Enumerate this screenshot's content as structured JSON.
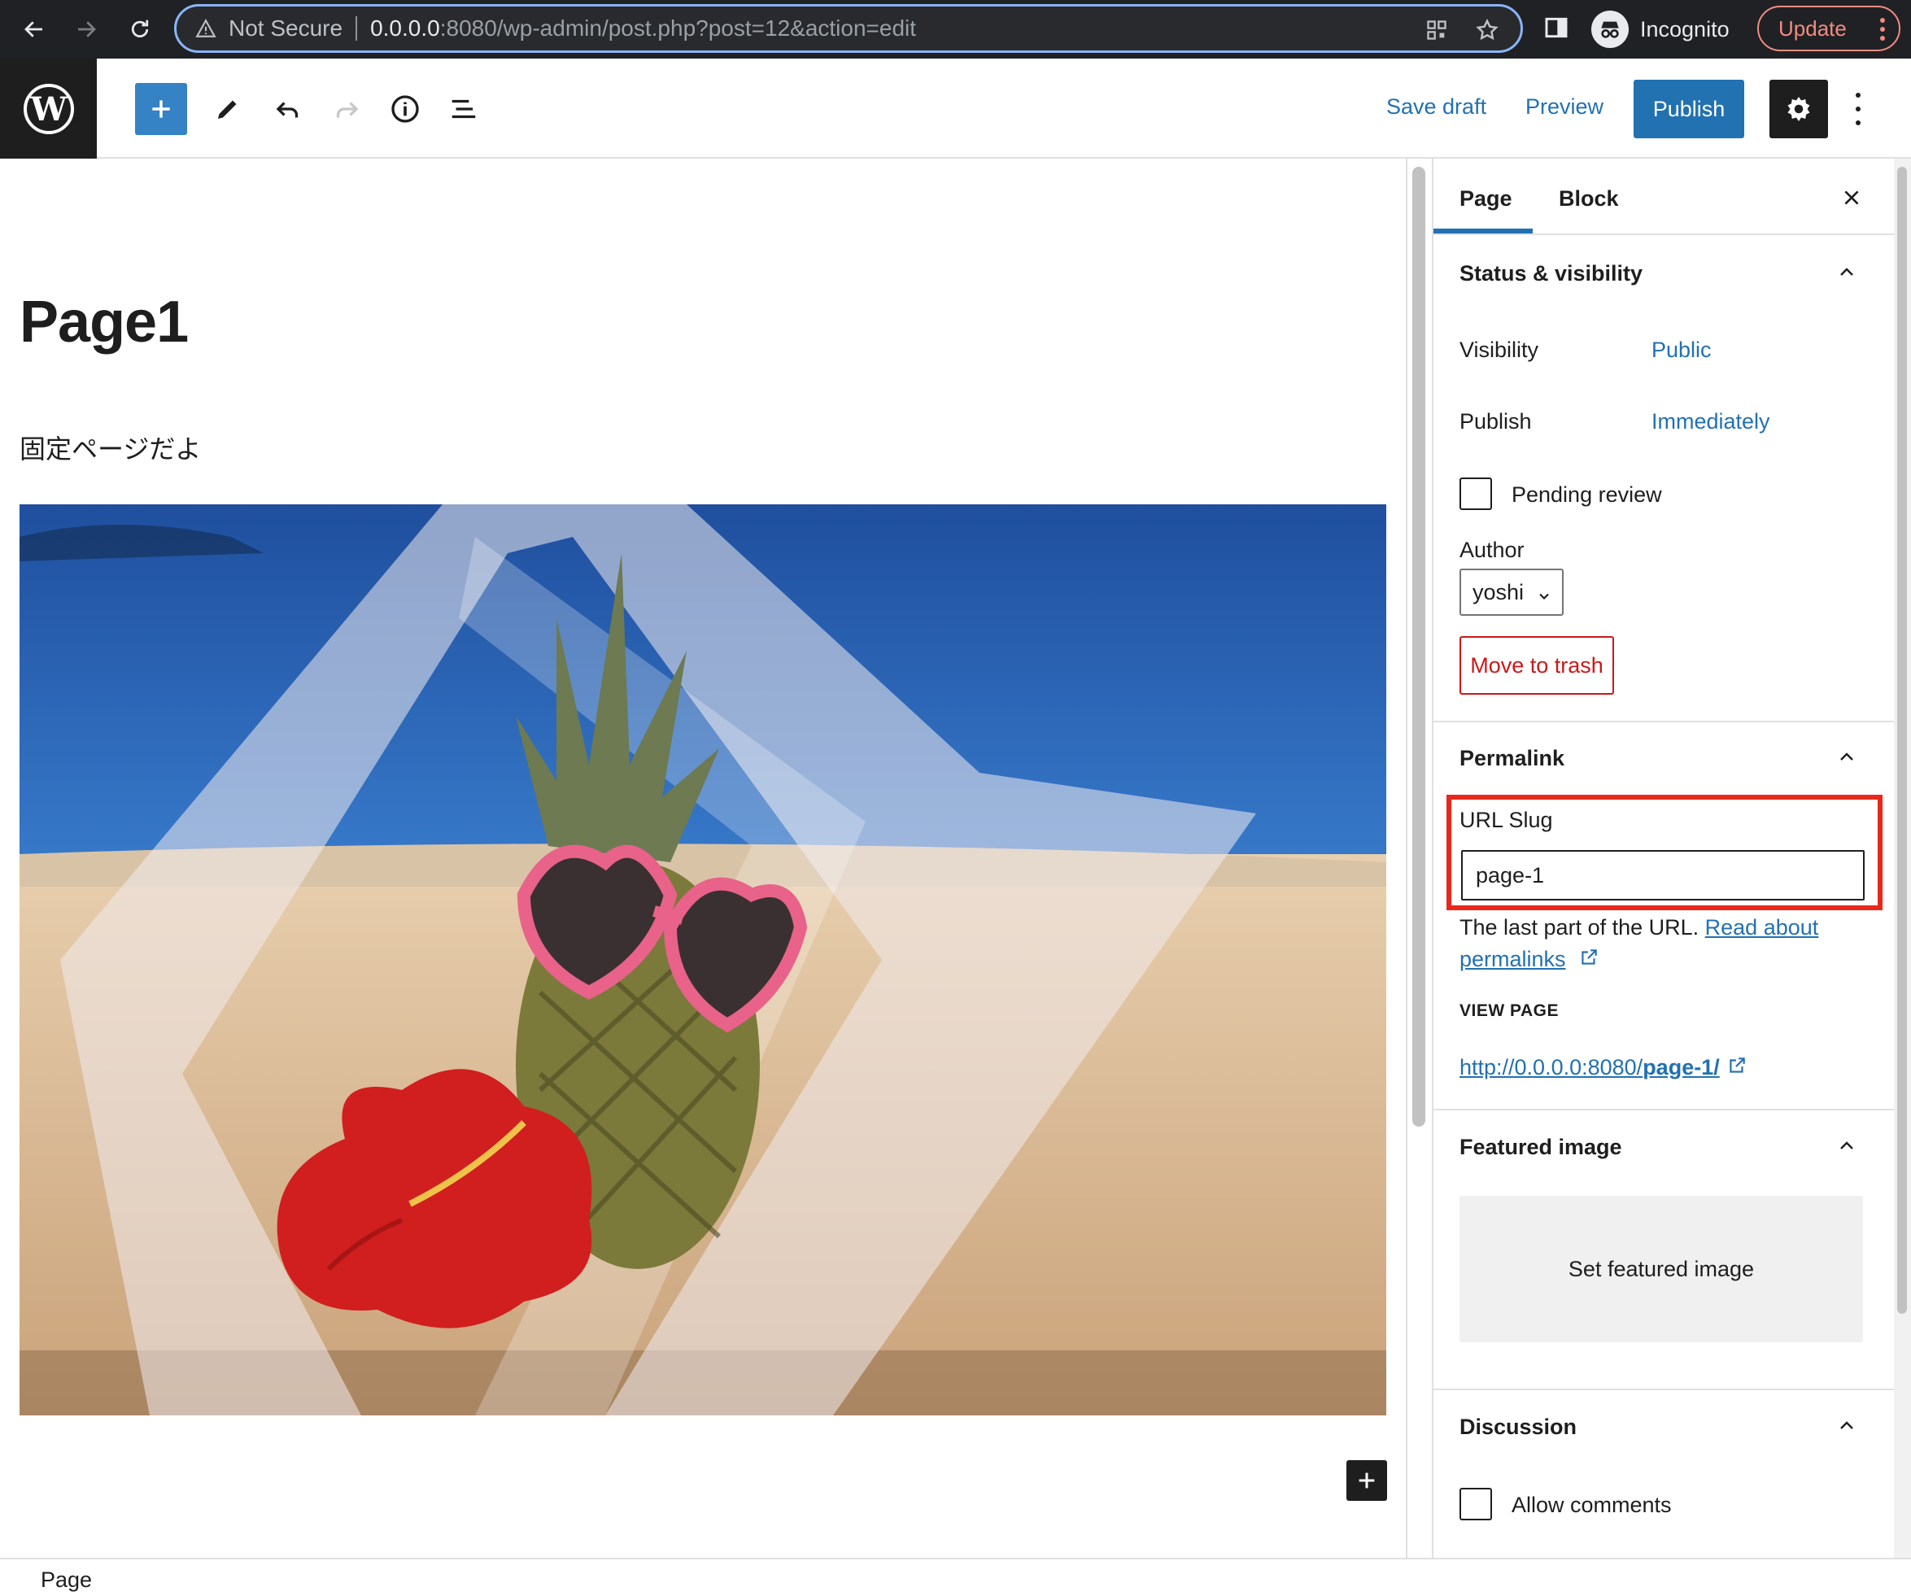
{
  "browser": {
    "security_label": "Not Secure",
    "url_host": "0.0.0.0",
    "url_path": ":8080/wp-admin/post.php?post=12&action=edit",
    "profile_label": "Incognito",
    "update_label": "Update"
  },
  "toolbar": {
    "save_draft_label": "Save draft",
    "preview_label": "Preview",
    "publish_label": "Publish"
  },
  "editor": {
    "title": "Page1",
    "paragraph": "固定ページだよ"
  },
  "sidebar": {
    "tabs": [
      {
        "label": "Page",
        "active": true
      },
      {
        "label": "Block",
        "active": false
      }
    ],
    "status_visibility": {
      "title": "Status & visibility",
      "visibility_label": "Visibility",
      "visibility_value": "Public",
      "publish_label": "Publish",
      "publish_value": "Immediately",
      "pending_review_label": "Pending review",
      "pending_review_checked": false,
      "author_label": "Author",
      "author_value": "yoshi",
      "trash_label": "Move to trash"
    },
    "permalink": {
      "title": "Permalink",
      "slug_label": "URL Slug",
      "slug_value": "page-1",
      "help_text": "The last part of the URL.",
      "help_link_1": "Read about",
      "help_link_2": "permalinks",
      "view_page_heading": "VIEW PAGE",
      "view_page_url_prefix": "http://0.0.0.0:8080/",
      "view_page_url_slug": "page-1/"
    },
    "featured_image": {
      "title": "Featured image",
      "button_label": "Set featured image"
    },
    "discussion": {
      "title": "Discussion",
      "allow_comments_label": "Allow comments",
      "allow_comments_checked": false
    }
  },
  "statusbar": {
    "breadcrumb": "Page"
  },
  "colors": {
    "accent": "#2271b1",
    "destructive": "#cc1818",
    "highlight_box": "#e8281b",
    "wp_dark": "#1e1e1e"
  }
}
